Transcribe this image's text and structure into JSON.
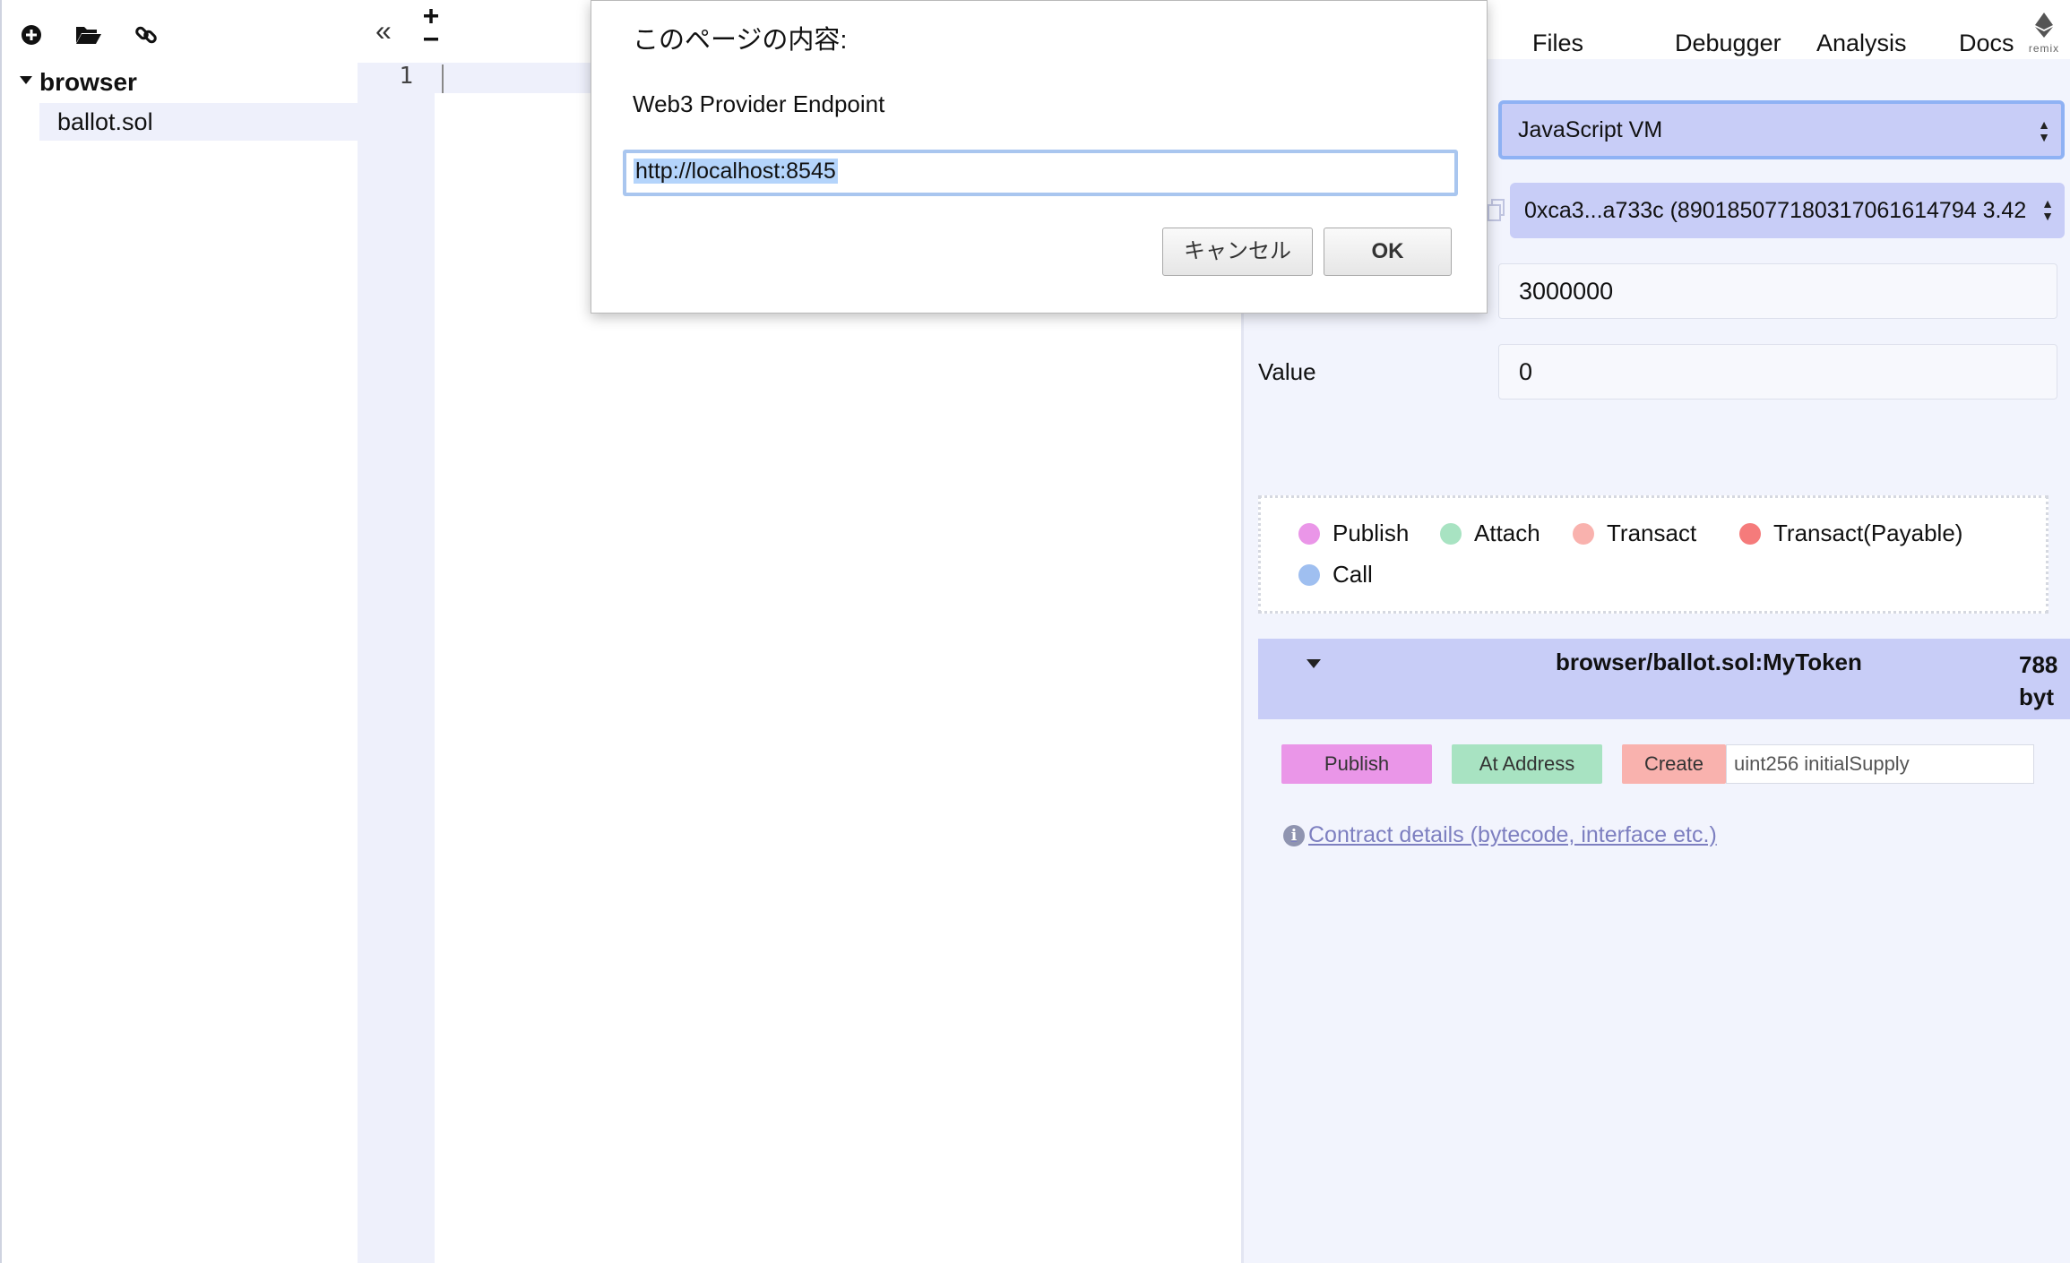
{
  "file_explorer": {
    "toolbar": [
      {
        "name": "create-file-button",
        "icon": "plus-circle-icon"
      },
      {
        "name": "open-folder-button",
        "icon": "folder-open-icon"
      },
      {
        "name": "connect-localhost-button",
        "icon": "link-icon"
      }
    ],
    "root_folder": "browser",
    "files": [
      "ballot.sol"
    ]
  },
  "editor": {
    "collapse_label": "«",
    "line_numbers": [
      "1"
    ]
  },
  "right_panel": {
    "tabs": [
      "Files",
      "Debugger",
      "Analysis",
      "Docs"
    ],
    "logo_text": "remix",
    "environment": "JavaScript VM",
    "account": "0xca3...a733c (890185077180317061614794 3.42",
    "gas_limit": "3000000",
    "value_label": "Value",
    "value": "0",
    "legend": [
      {
        "label": "Publish",
        "color": "#ea96e8"
      },
      {
        "label": "Attach",
        "color": "#a8e3c2"
      },
      {
        "label": "Transact",
        "color": "#f9b2ae"
      },
      {
        "label": "Transact(Payable)",
        "color": "#f57b7b"
      },
      {
        "label": "Call",
        "color": "#9fbff0"
      }
    ],
    "contract": {
      "name": "browser/ballot.sol:MyToken",
      "size_line1": "788",
      "size_line2": "byt"
    },
    "buttons": {
      "publish": "Publish",
      "at_address": "At Address",
      "create": "Create"
    },
    "create_args_placeholder": "uint256 initialSupply",
    "details_link": "Contract details (bytecode, interface etc.)",
    "colors": {
      "publish": "#ea96e8",
      "at_address": "#a8e3c2",
      "create": "#f9b2ae",
      "select_bg": "#c8cdf7"
    }
  },
  "dialog": {
    "title": "このページの内容:",
    "message": "Web3 Provider Endpoint",
    "input_value": "http://localhost:8545",
    "cancel_label": "キャンセル",
    "ok_label": "OK"
  }
}
